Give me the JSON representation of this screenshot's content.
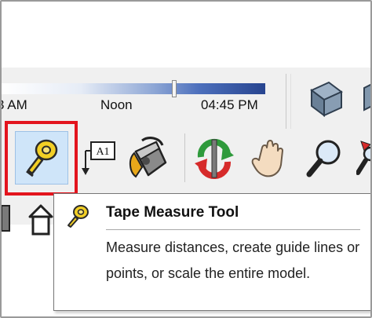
{
  "shadow_settings": {
    "time_left": "3 AM",
    "time_mid": "Noon",
    "time_right": "04:45 PM"
  },
  "toolbar": {
    "tools": [
      {
        "icon": "tape-measure-icon",
        "active": true
      },
      {
        "icon": "text-tool-icon",
        "label": "A1"
      },
      {
        "icon": "paint-bucket-icon"
      },
      {
        "icon": "orbit-icon"
      },
      {
        "icon": "pan-hand-icon"
      },
      {
        "icon": "zoom-magnifier-icon"
      },
      {
        "icon": "zoom-extents-icon"
      },
      {
        "icon": "iso-view-box-icon"
      }
    ],
    "highlight_color": "#e3141d",
    "active_bg": "#cfe5f9"
  },
  "tooltip": {
    "title": "Tape Measure Tool",
    "description": "Measure distances, create guide lines or points, or scale the entire model."
  }
}
